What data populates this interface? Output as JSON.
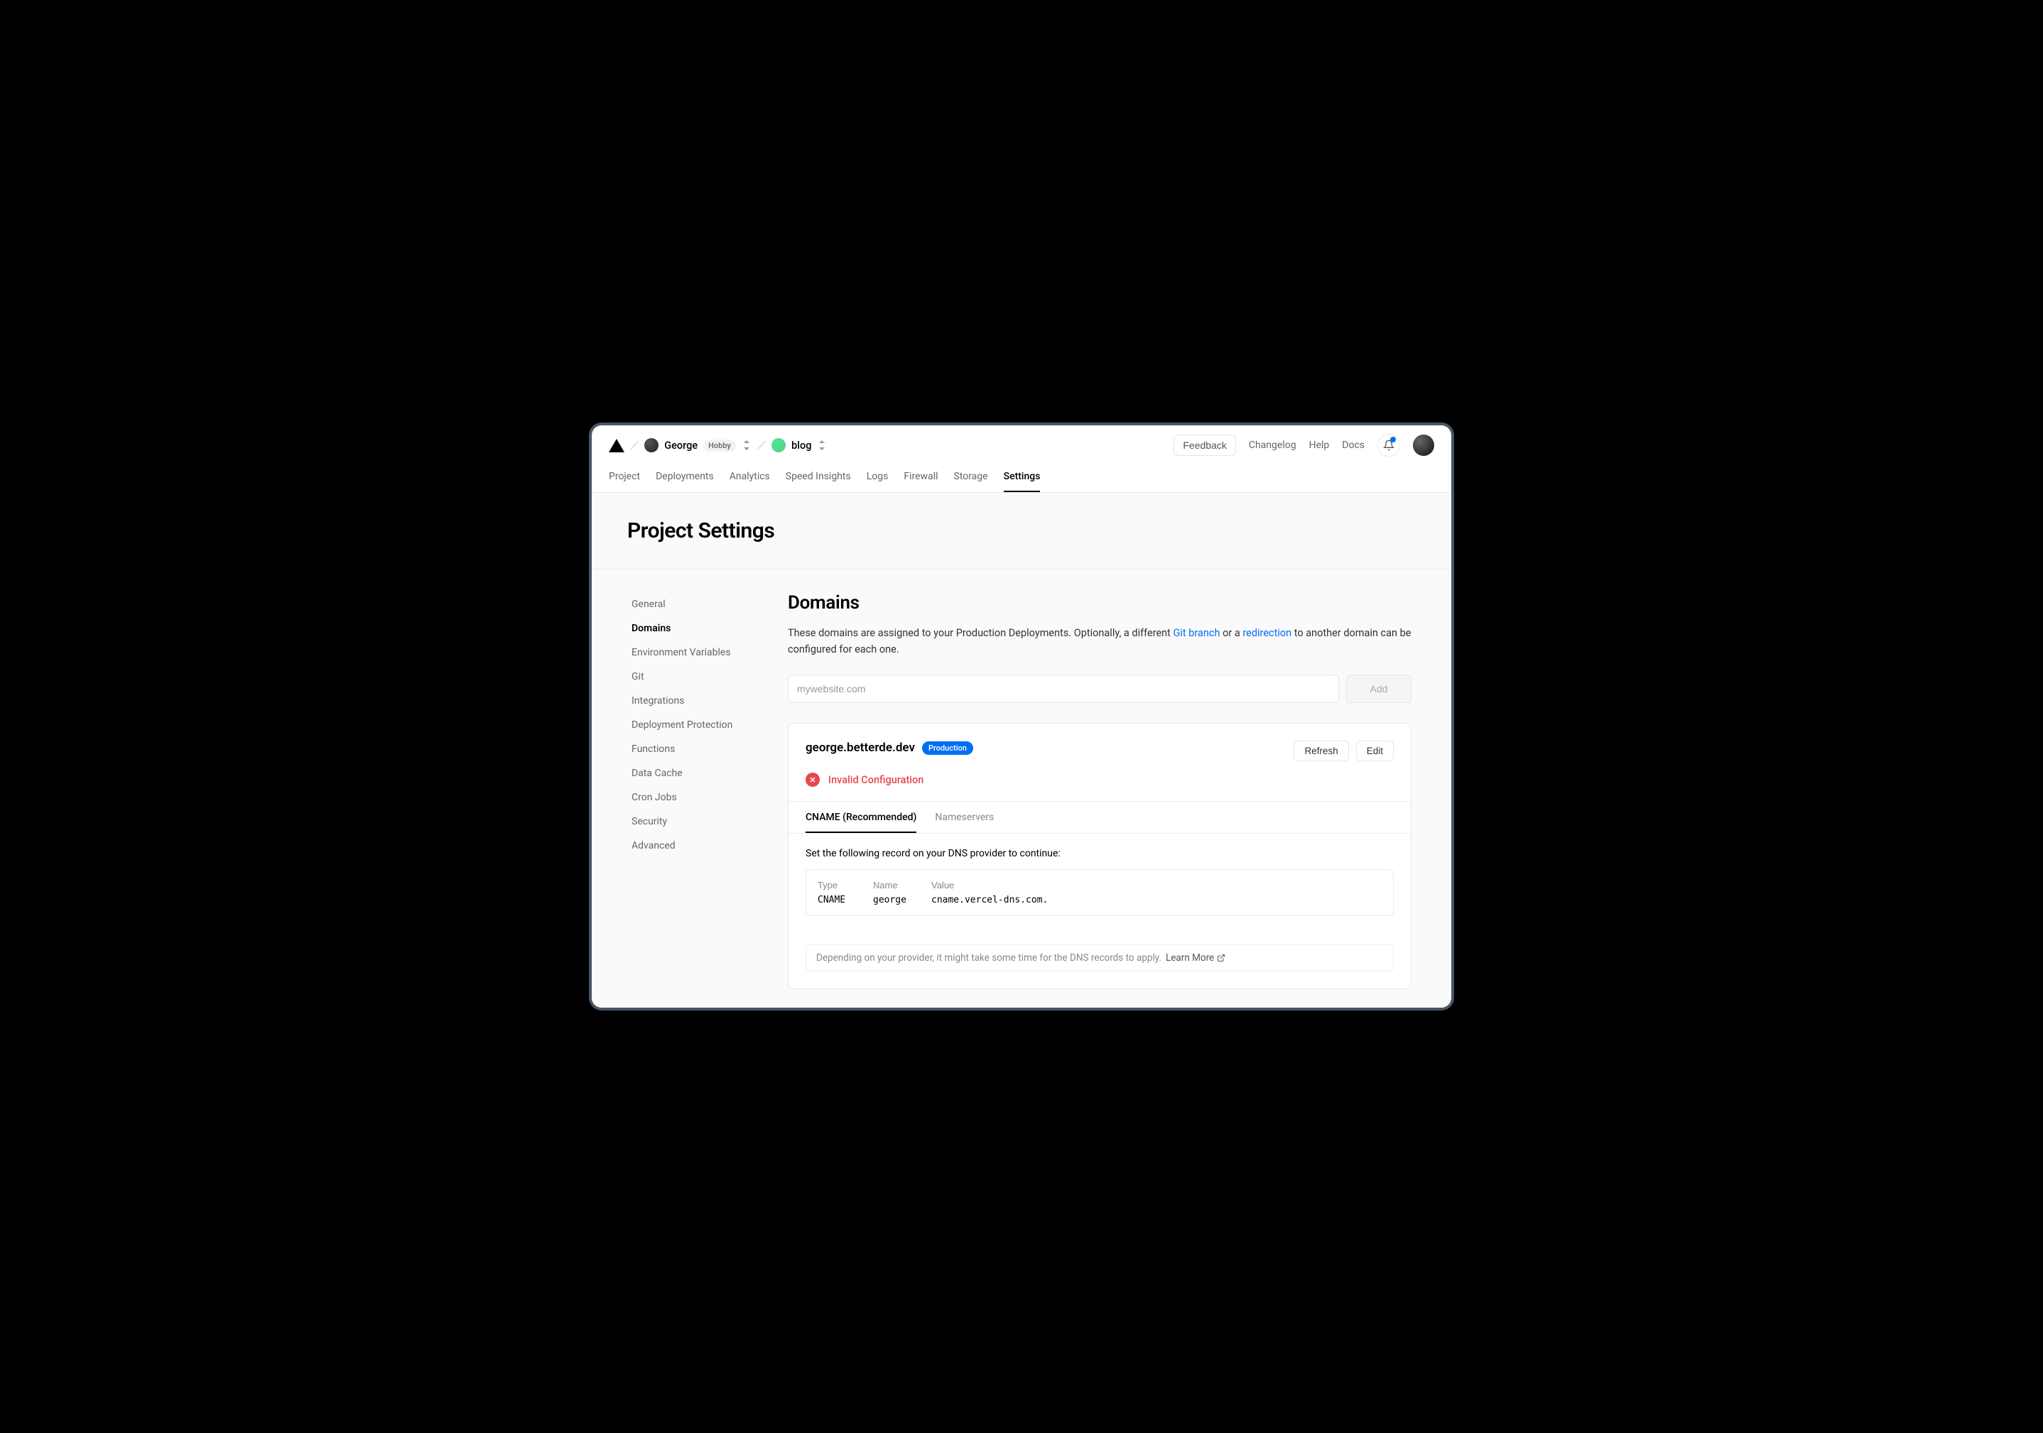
{
  "breadcrumb": {
    "user": "George",
    "plan": "Hobby",
    "project": "blog"
  },
  "topright": {
    "feedback": "Feedback",
    "links": [
      "Changelog",
      "Help",
      "Docs"
    ]
  },
  "navtabs": [
    "Project",
    "Deployments",
    "Analytics",
    "Speed Insights",
    "Logs",
    "Firewall",
    "Storage",
    "Settings"
  ],
  "navtabs_active": 7,
  "page_title": "Project Settings",
  "sidebar": {
    "items": [
      "General",
      "Domains",
      "Environment Variables",
      "Git",
      "Integrations",
      "Deployment Protection",
      "Functions",
      "Data Cache",
      "Cron Jobs",
      "Security",
      "Advanced"
    ],
    "active": 1
  },
  "content": {
    "heading": "Domains",
    "desc_pre": "These domains are assigned to your Production Deployments. Optionally, a different ",
    "desc_link1": "Git branch",
    "desc_mid": " or a ",
    "desc_link2": "redirection",
    "desc_post": " to another domain can be configured for each one.",
    "input_placeholder": "mywebsite.com",
    "add_label": "Add"
  },
  "domain_card": {
    "domain": "george.betterde.dev",
    "badge": "Production",
    "refresh": "Refresh",
    "edit": "Edit",
    "error": "Invalid Configuration",
    "subtabs": [
      "CNAME (Recommended)",
      "Nameservers"
    ],
    "subtabs_active": 0,
    "record_intro": "Set the following record on your DNS provider to continue:",
    "record": {
      "headers": {
        "type": "Type",
        "name": "Name",
        "value": "Value"
      },
      "type": "CNAME",
      "name": "george",
      "value": "cname.vercel-dns.com."
    },
    "note": "Depending on your provider, it might take some time for the DNS records to apply.",
    "learn_more": "Learn More"
  }
}
